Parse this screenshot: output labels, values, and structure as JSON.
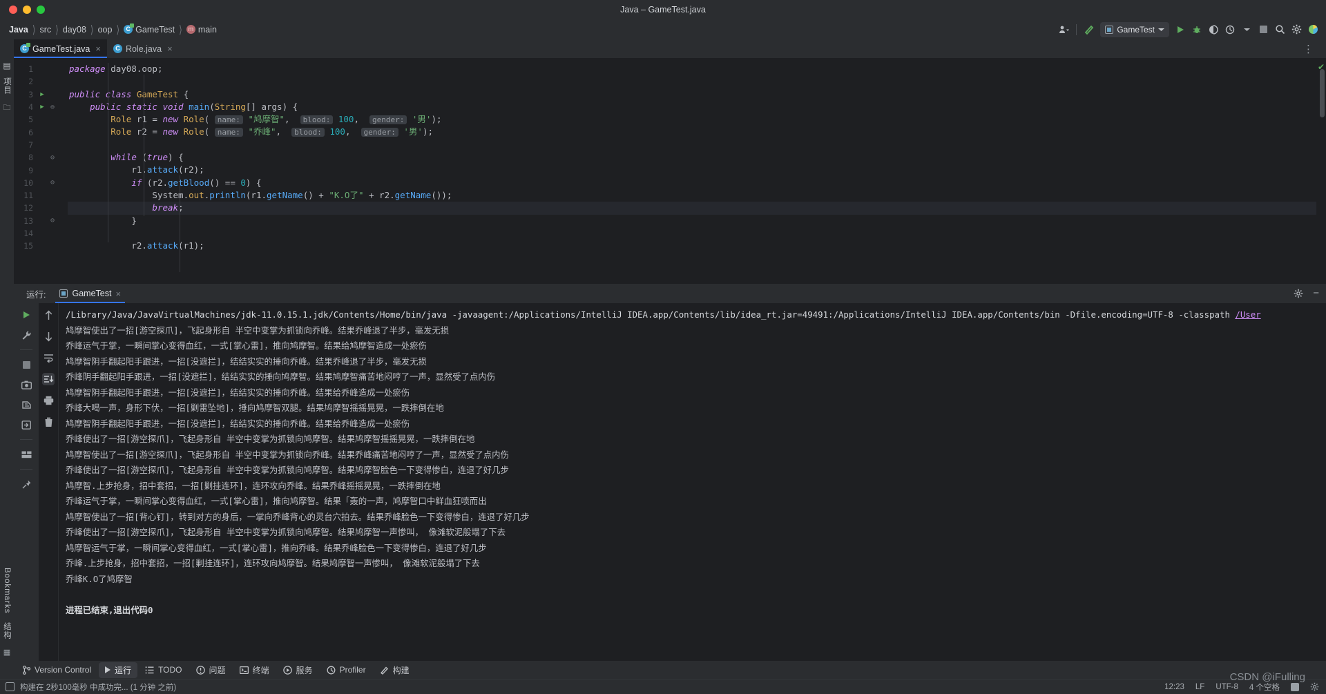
{
  "window": {
    "title": "Java – GameTest.java"
  },
  "breadcrumb": {
    "items": [
      {
        "label": "Java",
        "icon": "none"
      },
      {
        "label": "src",
        "icon": "none"
      },
      {
        "label": "day08",
        "icon": "none"
      },
      {
        "label": "oop",
        "icon": "none"
      },
      {
        "label": "GameTest",
        "icon": "class-icon"
      },
      {
        "label": "main",
        "icon": "method-icon"
      }
    ],
    "separator": "〉"
  },
  "toolbar": {
    "run_config": "GameTest",
    "buttons": [
      {
        "name": "profile-user-icon",
        "glyph": "👤"
      },
      {
        "name": "build-hammer-icon",
        "glyph": "↖"
      },
      {
        "name": "run-button",
        "glyph": "▶"
      },
      {
        "name": "debug-button",
        "glyph": "🐞"
      },
      {
        "name": "run-coverage-button",
        "glyph": "◑"
      },
      {
        "name": "profiler-button",
        "glyph": "◴"
      },
      {
        "name": "stop-button",
        "glyph": "■"
      },
      {
        "name": "search-everywhere-icon",
        "glyph": "🔍"
      },
      {
        "name": "settings-gear-icon",
        "glyph": "⚙"
      },
      {
        "name": "ide-assistant-icon",
        "glyph": "◖"
      }
    ]
  },
  "tabs": [
    {
      "label": "GameTest.java",
      "active": true,
      "icon": "java-class-runnable-icon",
      "close": "×"
    },
    {
      "label": "Role.java",
      "active": false,
      "icon": "java-class-icon",
      "close": "×"
    }
  ],
  "left_stripe": {
    "top_label": "项目",
    "bottom_labels": [
      "Bookmarks",
      "结构"
    ]
  },
  "editor": {
    "lines": [
      {
        "num": "1",
        "run": false,
        "fold": "",
        "html": "<span class=\"kw\">package</span> <span class=\"pl\">day08</span><span class=\"pl\">.oop;</span>"
      },
      {
        "num": "2",
        "run": false,
        "fold": "",
        "html": ""
      },
      {
        "num": "3",
        "run": true,
        "fold": "",
        "html": "<span class=\"kw\">public class</span> <span class=\"typ\">GameTest</span> <span class=\"pl\">{</span>"
      },
      {
        "num": "4",
        "run": true,
        "fold": "⊖",
        "html": "    <span class=\"kw\">public static void</span> <span class=\"fn\">main</span><span class=\"pl\">(</span><span class=\"typ\">String</span><span class=\"pl\">[] args) {</span>"
      },
      {
        "num": "5",
        "run": false,
        "fold": "",
        "html": "        <span class=\"typ\">Role</span> <span class=\"pl\">r1 = </span><span class=\"kw\">new</span> <span class=\"typ\">Role</span><span class=\"pl\">( </span><span class=\"hint\">name:</span> <span class=\"str\">\"鸠摩智\"</span><span class=\"pl\">,  </span><span class=\"hint\">blood:</span> <span class=\"num\">100</span><span class=\"pl\">,  </span><span class=\"hint\">gender:</span> <span class=\"str\">'男'</span><span class=\"pl\">);</span>"
      },
      {
        "num": "6",
        "run": false,
        "fold": "",
        "html": "        <span class=\"typ\">Role</span> <span class=\"pl\">r2 = </span><span class=\"kw\">new</span> <span class=\"typ\">Role</span><span class=\"pl\">( </span><span class=\"hint\">name:</span> <span class=\"str\">\"乔峰\"</span><span class=\"pl\">,  </span><span class=\"hint\">blood:</span> <span class=\"num\">100</span><span class=\"pl\">,  </span><span class=\"hint\">gender:</span> <span class=\"str\">'男'</span><span class=\"pl\">);</span>"
      },
      {
        "num": "7",
        "run": false,
        "fold": "",
        "html": ""
      },
      {
        "num": "8",
        "run": false,
        "fold": "⊖",
        "html": "        <span class=\"kw\">while</span> <span class=\"pl\">(</span><span class=\"kw\">true</span><span class=\"pl\">) {</span>"
      },
      {
        "num": "9",
        "run": false,
        "fold": "",
        "html": "            <span class=\"pl\">r1.</span><span class=\"fn\">attack</span><span class=\"pl\">(r2);</span>"
      },
      {
        "num": "10",
        "run": false,
        "fold": "⊖",
        "html": "            <span class=\"kw\">if</span> <span class=\"pl\">(r2.</span><span class=\"fn\">getBlood</span><span class=\"pl\">() == </span><span class=\"num\">0</span><span class=\"pl\">) {</span>"
      },
      {
        "num": "11",
        "run": false,
        "fold": "",
        "html": "                <span class=\"pl\">System.</span><span class=\"typ\">out</span><span class=\"pl\">.</span><span class=\"fn\">println</span><span class=\"pl\">(r1.</span><span class=\"fn\">getName</span><span class=\"pl\">() + </span><span class=\"str\">\"K.O了\"</span><span class=\"pl\"> + r2.</span><span class=\"fn\">getName</span><span class=\"pl\">());</span>"
      },
      {
        "num": "12",
        "run": false,
        "fold": "",
        "html": "                <span class=\"kw\">break</span><span class=\"pl\">;</span>",
        "highlight": true
      },
      {
        "num": "13",
        "run": false,
        "fold": "⊖",
        "html": "            <span class=\"pl\">}</span>"
      },
      {
        "num": "14",
        "run": false,
        "fold": "",
        "html": ""
      },
      {
        "num": "15",
        "run": false,
        "fold": "",
        "html": "            <span class=\"pl\">r2.</span><span class=\"fn\">attack</span><span class=\"pl\">(r1);</span>"
      }
    ]
  },
  "run_panel": {
    "label": "运行:",
    "tab": "GameTest",
    "close": "×",
    "tools_left": [
      {
        "name": "rerun-button",
        "glyph": "▶"
      },
      {
        "name": "settings-wrench-icon",
        "glyph": "🔧"
      },
      {
        "name": "stop-button",
        "glyph": "■"
      },
      {
        "name": "camera-snapshot-icon",
        "glyph": "📷"
      },
      {
        "name": "memory-dump-icon",
        "glyph": "⚙"
      },
      {
        "name": "export-icon",
        "glyph": "⬇"
      },
      {
        "name": "layout-icon",
        "glyph": "▤"
      },
      {
        "name": "pin-icon",
        "glyph": "📌"
      }
    ],
    "tools_right": [
      {
        "name": "scroll-up-icon",
        "glyph": "↑"
      },
      {
        "name": "scroll-down-icon",
        "glyph": "↓"
      },
      {
        "name": "soft-wrap-icon",
        "glyph": "↩"
      },
      {
        "name": "scroll-to-end-icon",
        "glyph": "⤓"
      },
      {
        "name": "print-icon",
        "glyph": "🖨"
      },
      {
        "name": "clear-all-icon",
        "glyph": "🗑"
      }
    ],
    "console": [
      {
        "text": "/Library/Java/JavaVirtualMachines/jdk-11.0.15.1.jdk/Contents/Home/bin/java -javaagent:/Applications/IntelliJ IDEA.app/Contents/lib/idea_rt.jar=49491:/Applications/IntelliJ IDEA.app/Contents/bin -Dfile.encoding=UTF-8 -classpath ",
        "link": "/User",
        "cmd": true
      },
      {
        "text": "鸠摩智使出了一招[游空探爪]，飞起身形自 半空中变掌为抓锁向乔峰。结果乔峰退了半步，毫发无损"
      },
      {
        "text": "乔峰运气于掌，一瞬间掌心变得血红，一式[掌心雷]，推向鸠摩智。结果给鸠摩智造成一处瘀伤"
      },
      {
        "text": "鸠摩智阴手翻起阳手跟进，一招[没遮拦]，结结实实的捶向乔峰。结果乔峰退了半步，毫发无损"
      },
      {
        "text": "乔峰阴手翻起阳手跟进，一招[没遮拦]，结结实实的捶向鸠摩智。结果鸠摩智痛苦地闷哼了一声，显然受了点内伤"
      },
      {
        "text": "鸠摩智阴手翻起阳手跟进，一招[没遮拦]，结结实实的捶向乔峰。结果给乔峰造成一处瘀伤"
      },
      {
        "text": "乔峰大喝一声，身形下伏，一招[剿雷坠地]，捶向鸠摩智双腿。结果鸠摩智摇摇晃晃，一跌摔倒在地"
      },
      {
        "text": "鸠摩智阴手翻起阳手跟进，一招[没遮拦]，结结实实的捶向乔峰。结果给乔峰造成一处瘀伤"
      },
      {
        "text": "乔峰使出了一招[游空探爪]，飞起身形自 半空中变掌为抓锁向鸠摩智。结果鸠摩智摇摇晃晃，一跌摔倒在地"
      },
      {
        "text": "鸠摩智使出了一招[游空探爪]，飞起身形自 半空中变掌为抓锁向乔峰。结果乔峰痛苦地闷哼了一声，显然受了点内伤"
      },
      {
        "text": "乔峰使出了一招[游空探爪]，飞起身形自 半空中变掌为抓锁向鸠摩智。结果鸠摩智脸色一下变得惨白，连退了好几步"
      },
      {
        "text": "鸠摩智.上步抢身，招中套招，一招[剿挂连环]，连环攻向乔峰。结果乔峰摇摇晃晃，一跌摔倒在地"
      },
      {
        "text": "乔峰运气于掌，一瞬间掌心变得血红，一式[掌心雷]，推向鸠摩智。结果「轰的一声，鸠摩智口中鲜血狂喷而出"
      },
      {
        "text": "鸠摩智使出了一招[背心钉]，转到对方的身后，一掌向乔峰背心的灵台穴拍去。结果乔峰脸色一下变得惨白，连退了好几步"
      },
      {
        "text": "乔峰使出了一招[游空探爪]，飞起身形自 半空中变掌为抓锁向鸠摩智。结果鸠摩智一声惨叫， 像滩软泥般塌了下去"
      },
      {
        "text": "鸠摩智运气于掌，一瞬间掌心变得血红，一式[掌心雷]，推向乔峰。结果乔峰脸色一下变得惨白，连退了好几步"
      },
      {
        "text": "乔峰.上步抢身，招中套招，一招[剿挂连环]，连环攻向鸠摩智。结果鸠摩智一声惨叫， 像滩软泥般塌了下去"
      },
      {
        "text": "乔峰K.O了鸠摩智"
      },
      {
        "text": ""
      },
      {
        "text": "进程已结束,退出代码0",
        "bold": true
      }
    ]
  },
  "bottom_bar": {
    "items": [
      {
        "label": "Version Control",
        "icon": "branch-icon",
        "active": false
      },
      {
        "label": "运行",
        "icon": "run-icon",
        "active": true
      },
      {
        "label": "TODO",
        "icon": "list-icon",
        "active": false
      },
      {
        "label": "问题",
        "icon": "warning-icon",
        "active": false
      },
      {
        "label": "终端",
        "icon": "terminal-icon",
        "active": false
      },
      {
        "label": "服务",
        "icon": "services-icon",
        "active": false
      },
      {
        "label": "Profiler",
        "icon": "profiler-icon",
        "active": false
      },
      {
        "label": "构建",
        "icon": "hammer-icon",
        "active": false
      }
    ]
  },
  "status_bar": {
    "build_message": "构建在 2秒100毫秒 中成功完... (1 分钟 之前)",
    "time": "12:23",
    "line_separator": "LF",
    "encoding": "UTF-8",
    "indent": "4 个空格"
  },
  "watermark": "CSDN @iFulling",
  "colors": {
    "background": "#2b2d30",
    "editor_background": "#1e1f22",
    "accent": "#3574f0",
    "run_green": "#5fad5f",
    "string_green": "#6aab73",
    "keyword_purple": "#cf8ef8",
    "type_yellow": "#d4a857",
    "method_blue": "#57aaf7"
  }
}
